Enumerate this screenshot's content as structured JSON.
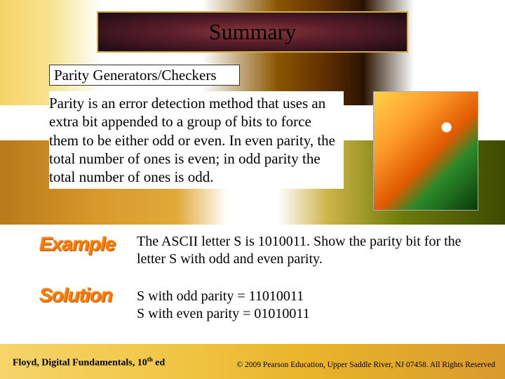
{
  "title": "Summary",
  "subheading": "Parity Generators/Checkers",
  "body": "Parity is an error detection method that uses an extra bit appended to a group of bits to force them to be either odd or even. In even parity, the total number of ones is even; in odd parity the total number of ones is odd.",
  "label_example": "Example",
  "label_solution": "Solution",
  "example": "The ASCII letter S is 1010011. Show the parity bit for the letter S with odd and even parity.",
  "solution_line1": "S with odd parity =  11010011",
  "solution_line2": "S with even parity = 01010011",
  "footer_left_pre": "Floyd, Digital Fundamentals, 10",
  "footer_left_sup": "th",
  "footer_left_post": " ed",
  "footer_right": "© 2009 Pearson Education, Upper Saddle River, NJ 07458. All Rights Reserved"
}
